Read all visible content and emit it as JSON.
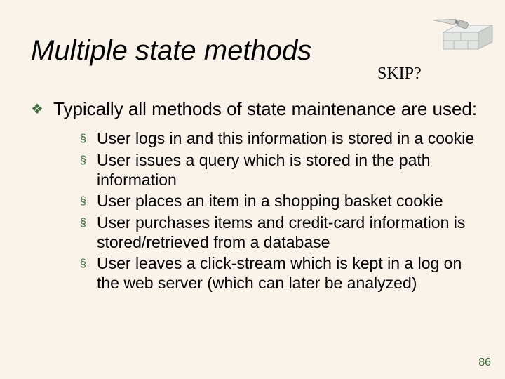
{
  "title": "Multiple state methods",
  "skip_label": "SKIP?",
  "main_point": {
    "bullet": "❖",
    "text": "Typically all methods of state maintenance are used:"
  },
  "sub_points": [
    {
      "bullet": "§",
      "text": "User logs in and this information is stored in a cookie"
    },
    {
      "bullet": "§",
      "text": "User issues a query which is stored in the path information"
    },
    {
      "bullet": "§",
      "text": "User places an item in a shopping basket cookie"
    },
    {
      "bullet": "§",
      "text": "User purchases items and credit-card information is stored/retrieved from a database"
    },
    {
      "bullet": "§",
      "text": "User leaves a click-stream which is kept in a log on the web server (which can later be analyzed)"
    }
  ],
  "page_number": "86",
  "decoration_name": "trowel-brick-icon"
}
